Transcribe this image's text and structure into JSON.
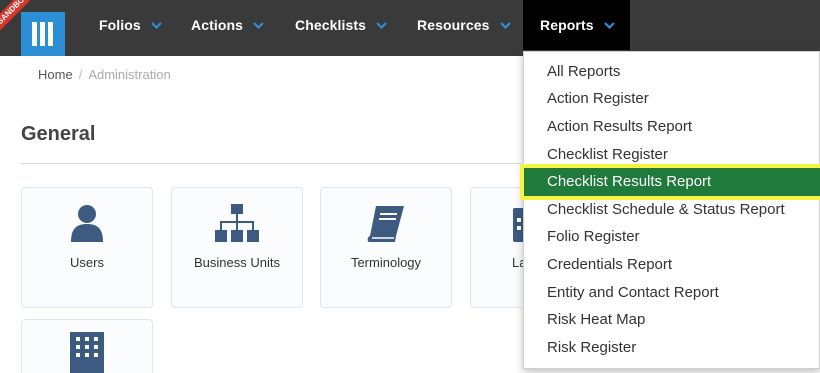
{
  "app": {
    "ribbon_text": "SANDBOX",
    "logo_icon": "app-logo-icon",
    "colors": {
      "nav_bg": "#3a3a3a",
      "logo": "#2c8fd6",
      "icon": "#3d5a80",
      "highlight_bg": "#1f7a3b",
      "highlight_outline": "#f4f441"
    }
  },
  "nav": {
    "items": [
      {
        "label": "Folios"
      },
      {
        "label": "Actions"
      },
      {
        "label": "Checklists"
      },
      {
        "label": "Resources"
      },
      {
        "label": "Reports",
        "active": true
      }
    ]
  },
  "breadcrumb": {
    "home": "Home",
    "separator": "/",
    "current": "Administration"
  },
  "section": {
    "title": "General"
  },
  "cards": [
    {
      "label": "Users",
      "icon": "user-icon"
    },
    {
      "label": "Business Units",
      "icon": "org-chart-icon"
    },
    {
      "label": "Terminology",
      "icon": "book-icon"
    },
    {
      "label": "La",
      "icon": "calendar-icon"
    },
    {
      "label": "",
      "icon": "building-icon"
    }
  ],
  "reports_menu": {
    "items": [
      {
        "label": "All Reports"
      },
      {
        "label": "Action Register"
      },
      {
        "label": "Action Results Report"
      },
      {
        "label": "Checklist Register"
      },
      {
        "label": "Checklist Results Report",
        "highlighted": true
      },
      {
        "label": "Checklist Schedule & Status Report"
      },
      {
        "label": "Folio Register"
      },
      {
        "label": "Credentials Report"
      },
      {
        "label": "Entity and Contact Report"
      },
      {
        "label": "Risk Heat Map"
      },
      {
        "label": "Risk Register"
      }
    ]
  }
}
